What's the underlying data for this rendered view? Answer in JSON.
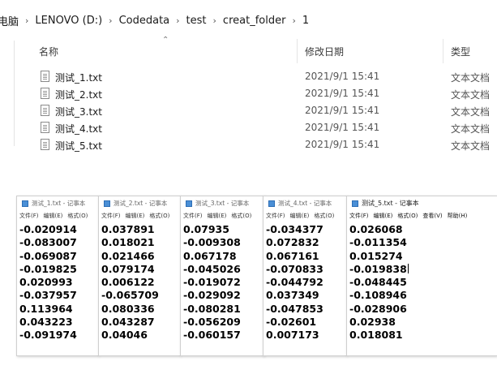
{
  "explorer": {
    "breadcrumb": [
      "电脑",
      "LENOVO (D:)",
      "Codedata",
      "test",
      "creat_folder",
      "1"
    ],
    "columns": {
      "name": "名称",
      "date": "修改日期",
      "type": "类型"
    },
    "files": [
      {
        "name": "测试_1.txt",
        "date": "2021/9/1 15:41",
        "type": "文本文档"
      },
      {
        "name": "测试_2.txt",
        "date": "2021/9/1 15:41",
        "type": "文本文档"
      },
      {
        "name": "测试_3.txt",
        "date": "2021/9/1 15:41",
        "type": "文本文档"
      },
      {
        "name": "测试_4.txt",
        "date": "2021/9/1 15:41",
        "type": "文本文档"
      },
      {
        "name": "测试_5.txt",
        "date": "2021/9/1 15:41",
        "type": "文本文档"
      }
    ]
  },
  "notepads": [
    {
      "title": "测试_1.txt - 记事本",
      "menu": [
        "文件(F)",
        "编辑(E)",
        "格式(O)"
      ],
      "values": [
        "-0.020914",
        "-0.083007",
        "-0.069087",
        "-0.019825",
        "0.020993",
        "-0.037957",
        "0.113964",
        "0.043223",
        "-0.091974"
      ]
    },
    {
      "title": "测试_2.txt - 记事本",
      "menu": [
        "文件(F)",
        "编辑(E)",
        "格式(O)"
      ],
      "values": [
        "0.037891",
        "0.018021",
        "0.021466",
        "0.079174",
        "0.006122",
        "-0.065709",
        "0.080336",
        "0.043287",
        "0.04046"
      ]
    },
    {
      "title": "测试_3.txt - 记事本",
      "menu": [
        "文件(F)",
        "编辑(E)",
        "格式(O)"
      ],
      "values": [
        "0.07935",
        "-0.009308",
        "0.067178",
        "-0.045026",
        "-0.019072",
        "-0.029092",
        "-0.080281",
        "-0.056209",
        "-0.060157"
      ]
    },
    {
      "title": "测试_4.txt - 记事本",
      "menu": [
        "文件(F)",
        "编辑(E)",
        "格式(O)"
      ],
      "values": [
        "-0.034377",
        "0.072832",
        "0.067161",
        "-0.070833",
        "-0.044792",
        "0.037349",
        "-0.047853",
        "-0.02601",
        "0.007173"
      ]
    },
    {
      "title": "测试_5.txt - 记事本",
      "menu": [
        "文件(F)",
        "编辑(E)",
        "格式(O)",
        "查看(V)",
        "帮助(H)"
      ],
      "values": [
        "0.026068",
        "-0.011354",
        "0.015274",
        "-0.019838",
        "-0.048445",
        "-0.108946",
        "-0.028906",
        "0.02938",
        "0.018081"
      ]
    }
  ]
}
